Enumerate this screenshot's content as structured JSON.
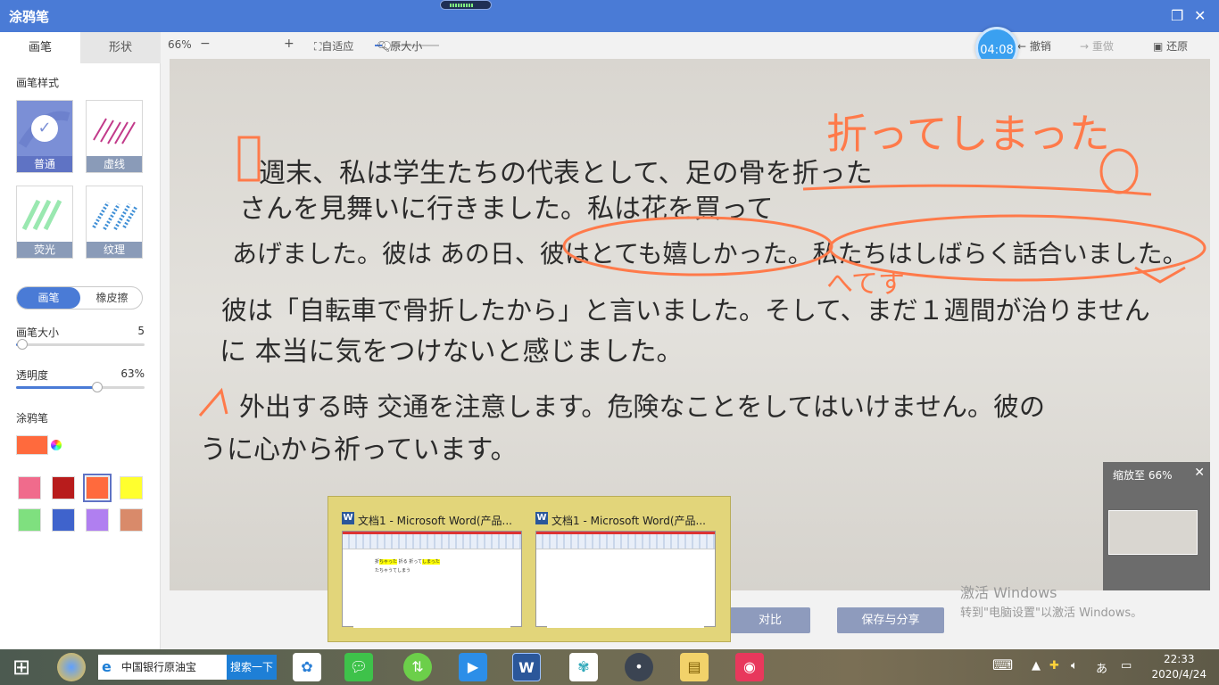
{
  "app": {
    "title": "涂鸦笔"
  },
  "sidebar": {
    "tabs": [
      "画笔",
      "形状"
    ],
    "style_section_label": "画笔样式",
    "styles": [
      {
        "label": "普通",
        "active": true
      },
      {
        "label": "虚线",
        "active": false
      },
      {
        "label": "荧光",
        "active": false
      },
      {
        "label": "纹理",
        "active": false
      }
    ],
    "modes": [
      "画笔",
      "橡皮擦"
    ],
    "size": {
      "label": "画笔大小",
      "value": "5",
      "fraction": 0.05
    },
    "opacity": {
      "label": "透明度",
      "value": "63%",
      "fraction": 0.63
    },
    "color_section_label": "涂鸦笔",
    "current_color": "#ff6a3d",
    "swatches": [
      "#f06b8c",
      "#b81c1c",
      "#ff6a3d",
      "#ffff2e",
      "#7fe07f",
      "#3f63cc",
      "#b07ff0",
      "#d98a6a"
    ],
    "selected_swatch": 2
  },
  "toolbar": {
    "zoom": "66%",
    "minus": "−",
    "plus": "+",
    "fit": "自适应",
    "original": "原大小",
    "undo": "撤销",
    "redo": "重做",
    "restore": "还原",
    "timer": "04:08"
  },
  "canvas_text": {
    "line1": "週末、私は学生たちの代表として、足の骨を折った",
    "line2": "さんを見舞いに行きました。私は花を買って",
    "line3": "あげました。彼は あの日、彼はとても嬉しかった。私たちはしばらく話合いました。",
    "line4": "彼は「自転車で骨折したから」と言いました。そして、まだ１週間が治りません",
    "line5": "に 本当に気をつけないと感じました。",
    "line6": "外出する時 交通を注意します。危険なことをしてはいけません。彼の",
    "line7": "うに心から祈っています。",
    "annotation_top": "折ってしまった",
    "annotation_mid": "へてす"
  },
  "bottom": {
    "compare": "对比",
    "save_share": "保存与分享",
    "activate_line1": "激活 Windows",
    "activate_line2": "转到\"电脑设置\"以激活 Windows。"
  },
  "zoom_popup": {
    "label": "缩放至",
    "value": "66%",
    "close": "✕"
  },
  "taskbar_preview": {
    "windows": [
      {
        "title": "文档1 - Microsoft Word(产品...",
        "doc_line1a": "折",
        "doc_line1b": "ちゃった",
        "doc_line1c": "折る 折って",
        "doc_line1d": "しまった",
        "doc_line2": "たちゃうてしまう"
      },
      {
        "title": "文档1 - Microsoft Word(产品..."
      }
    ]
  },
  "taskbar": {
    "search_text": "中国银行原油宝",
    "search_button": "搜索一下",
    "time": "22:33",
    "date": "2020/4/24",
    "ime": "あ"
  },
  "colors": {
    "accent": "#4a7bd6",
    "ink_orange": "#ff6a3d"
  }
}
